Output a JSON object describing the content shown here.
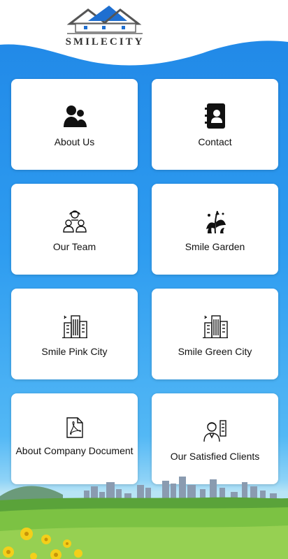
{
  "brand": {
    "name": "SMILECITY"
  },
  "cards": [
    {
      "label": "About Us",
      "icon": "people-icon"
    },
    {
      "label": "Contact",
      "icon": "contact-book-icon"
    },
    {
      "label": "Our Team",
      "icon": "team-icon"
    },
    {
      "label": "Smile Garden",
      "icon": "garden-icon"
    },
    {
      "label": "Smile Pink City",
      "icon": "city-buildings-icon"
    },
    {
      "label": "Smile Green City",
      "icon": "city-buildings-icon"
    },
    {
      "label": "About Company Document",
      "icon": "pdf-icon"
    },
    {
      "label": "Our Satisfied Clients",
      "icon": "client-icon"
    }
  ],
  "colors": {
    "background": "#2a94ee",
    "card": "#ffffff",
    "text": "#111111"
  }
}
